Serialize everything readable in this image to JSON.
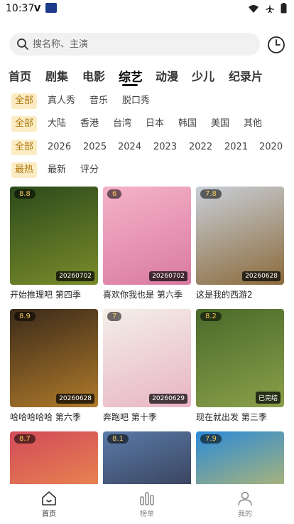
{
  "status_bar": {
    "time": "10:37",
    "letter": "V"
  },
  "search": {
    "placeholder": "搜名称、主演"
  },
  "category_tabs": [
    {
      "label": "首页"
    },
    {
      "label": "剧集"
    },
    {
      "label": "电影"
    },
    {
      "label": "综艺",
      "active": true
    },
    {
      "label": "动漫"
    },
    {
      "label": "少儿"
    },
    {
      "label": "纪录片"
    }
  ],
  "filters": {
    "type": [
      "全部",
      "真人秀",
      "音乐",
      "脱口秀"
    ],
    "region": [
      "全部",
      "大陆",
      "香港",
      "台湾",
      "日本",
      "韩国",
      "美国",
      "其他"
    ],
    "year": [
      "全部",
      "2026",
      "2025",
      "2024",
      "2023",
      "2022",
      "2021",
      "2020"
    ],
    "sort": [
      "最热",
      "最新",
      "评分"
    ]
  },
  "shows": [
    {
      "title": "开始推理吧 第四季",
      "score": "8.8",
      "badge": "20260702",
      "colors": [
        "#2c4a1c",
        "#7a8c2a"
      ]
    },
    {
      "title": "喜欢你我也是 第六季",
      "score": "6",
      "badge": "20260702",
      "colors": [
        "#f5b3c8",
        "#d97aa0"
      ]
    },
    {
      "title": "这是我的西游2",
      "score": "7.8",
      "badge": "20260628",
      "colors": [
        "#c9cfd8",
        "#8a6a3a"
      ]
    },
    {
      "title": "哈哈哈哈哈 第六季",
      "score": "8.9",
      "badge": "20260628",
      "colors": [
        "#3a2a1a",
        "#b07a2a"
      ]
    },
    {
      "title": "奔跑吧 第十季",
      "score": "7",
      "badge": "20260629",
      "colors": [
        "#f3efe8",
        "#e8b4c4"
      ]
    },
    {
      "title": "现在就出发 第三季",
      "score": "8.2",
      "badge": "已完结",
      "colors": [
        "#4a6a2a",
        "#8aa04a"
      ]
    },
    {
      "title": "",
      "score": "8.7",
      "badge": "",
      "colors": [
        "#d24a5a",
        "#f2a04a"
      ]
    },
    {
      "title": "",
      "score": "8.1",
      "badge": "",
      "colors": [
        "#5a7aa8",
        "#2a2a3a"
      ]
    },
    {
      "title": "",
      "score": "7.9",
      "badge": "",
      "colors": [
        "#2a8ad8",
        "#e8c84a"
      ]
    }
  ],
  "bottom_nav": [
    {
      "label": "首页",
      "icon": "home-icon",
      "active": true
    },
    {
      "label": "榜单",
      "icon": "chart-icon"
    },
    {
      "label": "我的",
      "icon": "user-icon"
    }
  ],
  "colors": {
    "accent_bg": "#fbecc4",
    "accent_text": "#b07a12"
  }
}
